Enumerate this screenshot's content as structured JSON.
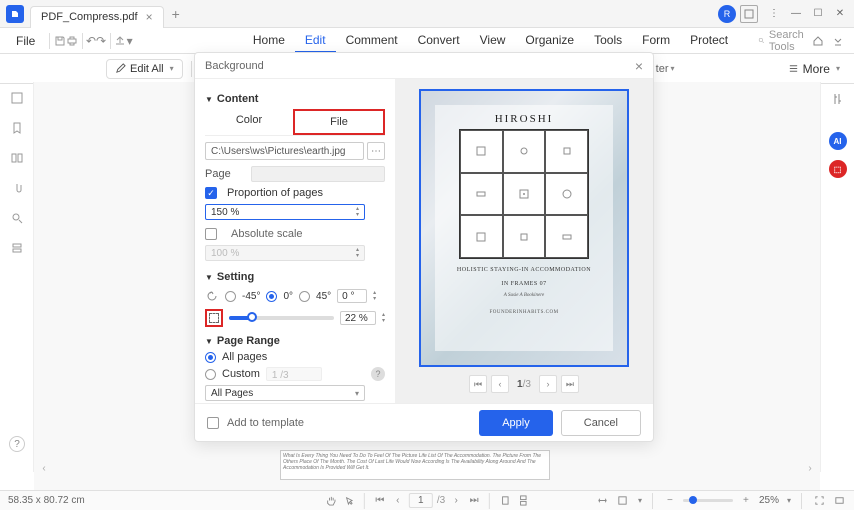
{
  "titlebar": {
    "filename": "PDF_Compress.pdf"
  },
  "menubar": {
    "file": "File",
    "items": [
      "Home",
      "Edit",
      "Comment",
      "Convert",
      "View",
      "Organize",
      "Tools",
      "Form",
      "Protect"
    ],
    "active": 1,
    "search": "Search Tools"
  },
  "toolbar": {
    "editall": "Edit All",
    "filter_suffix": "ter",
    "more": "More"
  },
  "dialog": {
    "title": "Background",
    "content": {
      "heading": "Content",
      "tab_color": "Color",
      "tab_file": "File",
      "path": "C:\\Users\\ws\\Pictures\\earth.jpg",
      "page_label": "Page",
      "proportion_label": "Proportion of pages",
      "proportion_value": "150 %",
      "absolute_label": "Absolute scale",
      "absolute_value": "100 %"
    },
    "setting": {
      "heading": "Setting",
      "angles": [
        "-45°",
        "0°",
        "45°"
      ],
      "angle_value": "0 °",
      "opacity_pct": 22,
      "opacity_value": "22 %"
    },
    "pagerange": {
      "heading": "Page Range",
      "all_pages": "All pages",
      "custom": "Custom",
      "custom_hint": "1 /3",
      "all_pages_select": "All Pages"
    },
    "footer": {
      "add_template": "Add to template",
      "apply": "Apply",
      "cancel": "Cancel"
    },
    "preview": {
      "title": "HIROSHI",
      "subtitle1": "HOLISTIC STAYING-IN ACCOMMODATION",
      "subtitle2": "IN FRAMES 07",
      "author": "A Susie A Bookinere",
      "footer": "FOUNDERINHABITS.COM",
      "page_current": "1",
      "page_total": "/3"
    }
  },
  "statusbar": {
    "dimensions": "58.35 x 80.72 cm",
    "page_current": "1",
    "page_total": "/3",
    "zoom": "25%"
  }
}
